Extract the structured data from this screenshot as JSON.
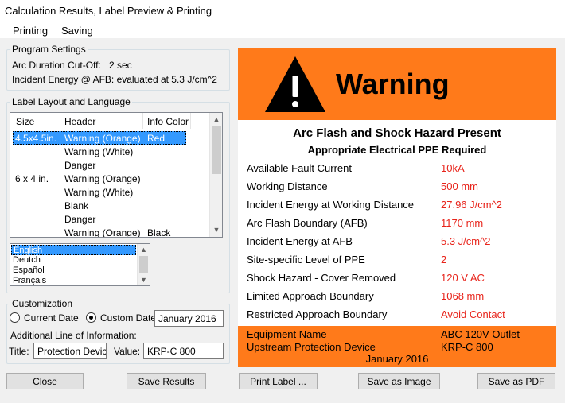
{
  "window": {
    "title": "Calculation Results, Label Preview & Printing"
  },
  "menu": [
    "Printing",
    "Saving"
  ],
  "program_settings": {
    "legend": "Program Settings",
    "arc_duration_label": "Arc Duration Cut-Off:",
    "arc_duration_value": "2 sec",
    "incident_energy_line": "Incident Energy @ AFB: evaluated at 5.3 J/cm^2"
  },
  "layout": {
    "legend": "Label Layout and Language",
    "columns": [
      "Size",
      "Header",
      "Info Color"
    ],
    "rows": [
      {
        "size": "4.5x4.5in.",
        "header": "Warning (Orange)",
        "color": "Red"
      },
      {
        "size": "",
        "header": "Warning (White)",
        "color": ""
      },
      {
        "size": "",
        "header": "Danger",
        "color": ""
      },
      {
        "size": "6 x 4 in.",
        "header": "Warning (Orange)",
        "color": ""
      },
      {
        "size": "",
        "header": "Warning (White)",
        "color": ""
      },
      {
        "size": "",
        "header": "Blank",
        "color": ""
      },
      {
        "size": "",
        "header": "Danger",
        "color": ""
      },
      {
        "size": "",
        "header": "Warning (Orange)",
        "color": "Black"
      }
    ],
    "languages": [
      "English",
      "Deutch",
      "Español",
      "Français"
    ]
  },
  "customization": {
    "legend": "Customization",
    "current_date": "Current Date",
    "custom_date": "Custom Date",
    "custom_date_value": "January 2016",
    "additional_line": "Additional Line of Information:",
    "title_label": "Title:",
    "title_value": "Protection Device",
    "value_label": "Value:",
    "value_value": "KRP-C 800"
  },
  "label": {
    "header": "Warning",
    "hazard": "Arc Flash and Shock Hazard Present",
    "ppe": "Appropriate Electrical PPE Required",
    "rows": [
      {
        "k": "Available Fault Current",
        "v": "10kA"
      },
      {
        "k": "Working Distance",
        "v": "500 mm"
      },
      {
        "k": "Incident Energy at Working Distance",
        "v": "27.96 J/cm^2"
      },
      {
        "k": "Arc Flash Boundary (AFB)",
        "v": "1170 mm"
      },
      {
        "k": "Incident Energy at AFB",
        "v": "5.3 J/cm^2"
      },
      {
        "k": "Site-specific Level of PPE",
        "v": "2"
      },
      {
        "k": "Shock Hazard - Cover Removed",
        "v": "120 V AC"
      },
      {
        "k": "Limited Approach Boundary",
        "v": "1068 mm"
      },
      {
        "k": "Restricted Approach Boundary",
        "v": "Avoid Contact"
      }
    ],
    "equipment_name_label": "Equipment Name",
    "equipment_name_value": "ABC 120V Outlet",
    "upstream_label": "Upstream Protection Device",
    "upstream_value": "KRP-C 800",
    "date": "January 2016",
    "colors": {
      "header_bg": "#ff7a1a",
      "value": "#e8231a"
    }
  },
  "buttons": {
    "close": "Close",
    "save_results": "Save Results",
    "print_label": "Print Label ...",
    "save_image": "Save as Image",
    "save_pdf": "Save as PDF"
  }
}
